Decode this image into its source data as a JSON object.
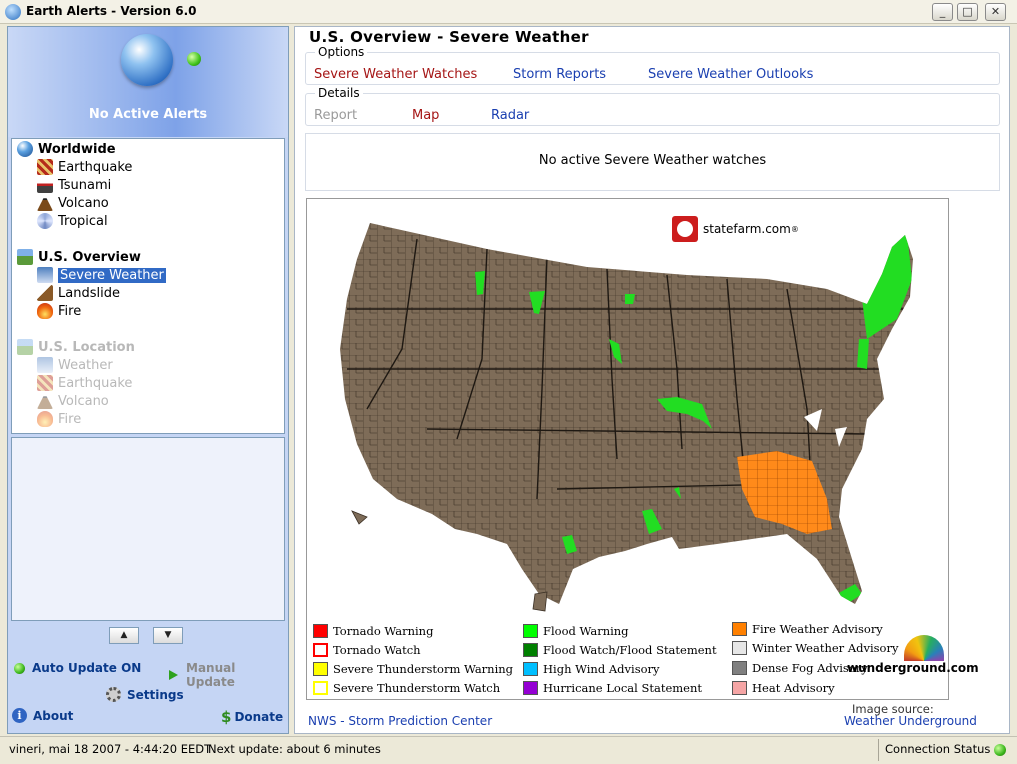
{
  "window": {
    "title": "Earth Alerts - Version 6.0"
  },
  "left_panel": {
    "alert_status": "No Active Alerts",
    "tree": {
      "worldwide": {
        "label": "Worldwide",
        "items": [
          "Earthquake",
          "Tsunami",
          "Volcano",
          "Tropical"
        ]
      },
      "us_overview": {
        "label": "U.S. Overview",
        "items": [
          "Severe Weather",
          "Landslide",
          "Fire"
        ],
        "selected": "Severe Weather"
      },
      "us_location": {
        "label": "U.S. Location",
        "items": [
          "Weather",
          "Earthquake",
          "Volcano",
          "Fire"
        ],
        "disabled": true
      }
    },
    "controls": {
      "auto_update": "Auto Update ON",
      "manual_update": "Manual Update",
      "settings": "Settings",
      "about": "About",
      "donate": "Donate"
    }
  },
  "main": {
    "title": "U.S. Overview - Severe Weather",
    "options": {
      "caption": "Options",
      "links": [
        "Severe Weather Watches",
        "Storm Reports",
        "Severe Weather Outlooks"
      ],
      "active": "Severe Weather Watches"
    },
    "details": {
      "caption": "Details",
      "links": [
        "Report",
        "Map",
        "Radar"
      ]
    },
    "message": "No active Severe Weather watches",
    "map": {
      "sponsor": "statefarm.com",
      "sponsor_mark": "®",
      "provider": "wunderground.com",
      "legend": [
        {
          "label": "Tornado Warning",
          "color": "#ff0000",
          "hollow": false
        },
        {
          "label": "Tornado Watch",
          "color": "#ff0000",
          "hollow": true
        },
        {
          "label": "Severe Thunderstorm Warning",
          "color": "#ffff00",
          "hollow": false
        },
        {
          "label": "Severe Thunderstorm Watch",
          "color": "#ffff00",
          "hollow": true
        },
        {
          "label": "Flood Warning",
          "color": "#00ff00",
          "hollow": false
        },
        {
          "label": "Flood Watch/Flood Statement",
          "color": "#008000",
          "hollow": false
        },
        {
          "label": "High Wind Advisory",
          "color": "#00bfff",
          "hollow": false
        },
        {
          "label": "Hurricane Local Statement",
          "color": "#9400d3",
          "hollow": false
        },
        {
          "label": "Fire Weather Advisory",
          "color": "#ff8000",
          "hollow": false
        },
        {
          "label": "Winter Weather Advisory",
          "color": "#e6e6e6",
          "hollow": false
        },
        {
          "label": "Dense Fog Advisory",
          "color": "#808080",
          "hollow": false
        },
        {
          "label": "Heat Advisory",
          "color": "#f5a5a5",
          "hollow": false
        }
      ],
      "colors": {
        "county_fill": "#7e6c58",
        "county_border": "#3a2f24",
        "flood": "#22dd22",
        "fire": "#ff8a1a"
      }
    },
    "image_source_label": "Image source:",
    "source_links": {
      "nws": "NWS - Storm Prediction Center",
      "wu": "Weather Underground"
    }
  },
  "status_bar": {
    "datetime": "vineri, mai 18 2007 - 4:44:20  EEDT",
    "next_update": "Next update: about 6 minutes",
    "connection": "Connection Status"
  }
}
